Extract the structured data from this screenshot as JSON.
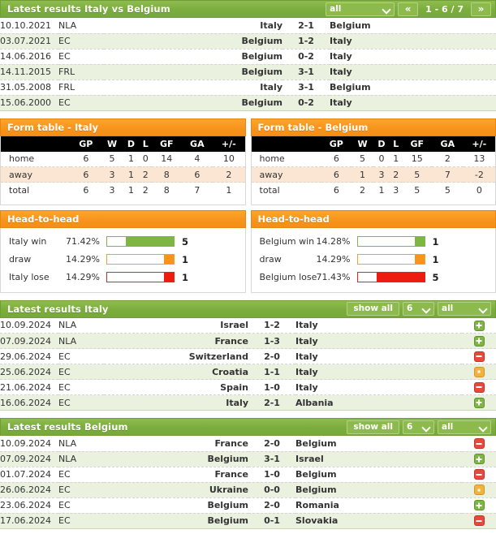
{
  "colors": {
    "green_header": "#7cae3e",
    "orange_header": "#f7941d",
    "win": "#7fb542",
    "draw": "#f7941d",
    "lose": "#ec1c11",
    "row_alt": "#eaf2df",
    "form_row_alt": "#fbe6d4"
  },
  "h2h_section": {
    "title": "Latest results Italy vs Belgium",
    "filter": {
      "label": "all",
      "icon": "chevron-down-icon"
    },
    "pager": {
      "prev_icon": "«",
      "next_icon": "»",
      "text": "1 - 6 / 7"
    },
    "rows": [
      {
        "date": "10.10.2021",
        "comp": "NLA",
        "home": "Italy",
        "score": "2-1",
        "away": "Belgium"
      },
      {
        "date": "03.07.2021",
        "comp": "EC",
        "home": "Belgium",
        "score": "1-2",
        "away": "Italy"
      },
      {
        "date": "14.06.2016",
        "comp": "EC",
        "home": "Belgium",
        "score": "0-2",
        "away": "Italy"
      },
      {
        "date": "14.11.2015",
        "comp": "FRL",
        "home": "Belgium",
        "score": "3-1",
        "away": "Italy"
      },
      {
        "date": "31.05.2008",
        "comp": "FRL",
        "home": "Italy",
        "score": "3-1",
        "away": "Belgium"
      },
      {
        "date": "15.06.2000",
        "comp": "EC",
        "home": "Belgium",
        "score": "0-2",
        "away": "Italy"
      }
    ]
  },
  "form_italy": {
    "title": "Form table - Italy",
    "headers": [
      "",
      "GP",
      "W",
      "D",
      "L",
      "GF",
      "GA",
      "+/-"
    ],
    "rows": [
      {
        "label": "home",
        "gp": "6",
        "w": "5",
        "d": "1",
        "l": "0",
        "gf": "14",
        "ga": "4",
        "diff": "10"
      },
      {
        "label": "away",
        "gp": "6",
        "w": "3",
        "d": "1",
        "l": "2",
        "gf": "8",
        "ga": "6",
        "diff": "2"
      },
      {
        "label": "total",
        "gp": "6",
        "w": "3",
        "d": "1",
        "l": "2",
        "gf": "8",
        "ga": "7",
        "diff": "1"
      }
    ]
  },
  "form_belgium": {
    "title": "Form table - Belgium",
    "headers": [
      "",
      "GP",
      "W",
      "D",
      "L",
      "GF",
      "GA",
      "+/-"
    ],
    "rows": [
      {
        "label": "home",
        "gp": "6",
        "w": "5",
        "d": "0",
        "l": "1",
        "gf": "15",
        "ga": "2",
        "diff": "13"
      },
      {
        "label": "away",
        "gp": "6",
        "w": "1",
        "d": "3",
        "l": "2",
        "gf": "5",
        "ga": "7",
        "diff": "-2"
      },
      {
        "label": "total",
        "gp": "6",
        "w": "2",
        "d": "1",
        "l": "3",
        "gf": "5",
        "ga": "5",
        "diff": "0"
      }
    ]
  },
  "h2h_italy": {
    "title": "Head-to-head",
    "rows": [
      {
        "label": "Italy win",
        "pct": "71.42%",
        "fill": 71.42,
        "count": "5",
        "kind": "win"
      },
      {
        "label": "draw",
        "pct": "14.29%",
        "fill": 14.29,
        "count": "1",
        "kind": "draw"
      },
      {
        "label": "Italy lose",
        "pct": "14.29%",
        "fill": 14.29,
        "count": "1",
        "kind": "lose"
      }
    ]
  },
  "h2h_belgium": {
    "title": "Head-to-head",
    "rows": [
      {
        "label": "Belgium win",
        "pct": "14.28%",
        "fill": 14.28,
        "count": "1",
        "kind": "win"
      },
      {
        "label": "draw",
        "pct": "14.29%",
        "fill": 14.29,
        "count": "1",
        "kind": "draw"
      },
      {
        "label": "Belgium lose",
        "pct": "71.43%",
        "fill": 71.43,
        "count": "5",
        "kind": "lose"
      }
    ]
  },
  "latest_italy": {
    "title": "Latest results Italy",
    "show_all_label": "show all",
    "count_select": {
      "label": "6",
      "icon": "chevron-down-icon"
    },
    "comp_select": {
      "label": "all",
      "icon": "chevron-down-icon"
    },
    "rows": [
      {
        "date": "10.09.2024",
        "comp": "NLA",
        "home": "Israel",
        "score": "1-2",
        "away": "Italy",
        "result": "w"
      },
      {
        "date": "07.09.2024",
        "comp": "NLA",
        "home": "France",
        "score": "1-3",
        "away": "Italy",
        "result": "w"
      },
      {
        "date": "29.06.2024",
        "comp": "EC",
        "home": "Switzerland",
        "score": "2-0",
        "away": "Italy",
        "result": "l"
      },
      {
        "date": "25.06.2024",
        "comp": "EC",
        "home": "Croatia",
        "score": "1-1",
        "away": "Italy",
        "result": "d"
      },
      {
        "date": "21.06.2024",
        "comp": "EC",
        "home": "Spain",
        "score": "1-0",
        "away": "Italy",
        "result": "l"
      },
      {
        "date": "16.06.2024",
        "comp": "EC",
        "home": "Italy",
        "score": "2-1",
        "away": "Albania",
        "result": "w"
      }
    ]
  },
  "latest_belgium": {
    "title": "Latest results Belgium",
    "show_all_label": "show all",
    "count_select": {
      "label": "6",
      "icon": "chevron-down-icon"
    },
    "comp_select": {
      "label": "all",
      "icon": "chevron-down-icon"
    },
    "rows": [
      {
        "date": "10.09.2024",
        "comp": "NLA",
        "home": "France",
        "score": "2-0",
        "away": "Belgium",
        "result": "l"
      },
      {
        "date": "07.09.2024",
        "comp": "NLA",
        "home": "Belgium",
        "score": "3-1",
        "away": "Israel",
        "result": "w"
      },
      {
        "date": "01.07.2024",
        "comp": "EC",
        "home": "France",
        "score": "1-0",
        "away": "Belgium",
        "result": "l"
      },
      {
        "date": "26.06.2024",
        "comp": "EC",
        "home": "Ukraine",
        "score": "0-0",
        "away": "Belgium",
        "result": "d"
      },
      {
        "date": "23.06.2024",
        "comp": "EC",
        "home": "Belgium",
        "score": "2-0",
        "away": "Romania",
        "result": "w"
      },
      {
        "date": "17.06.2024",
        "comp": "EC",
        "home": "Belgium",
        "score": "0-1",
        "away": "Slovakia",
        "result": "l"
      }
    ]
  }
}
